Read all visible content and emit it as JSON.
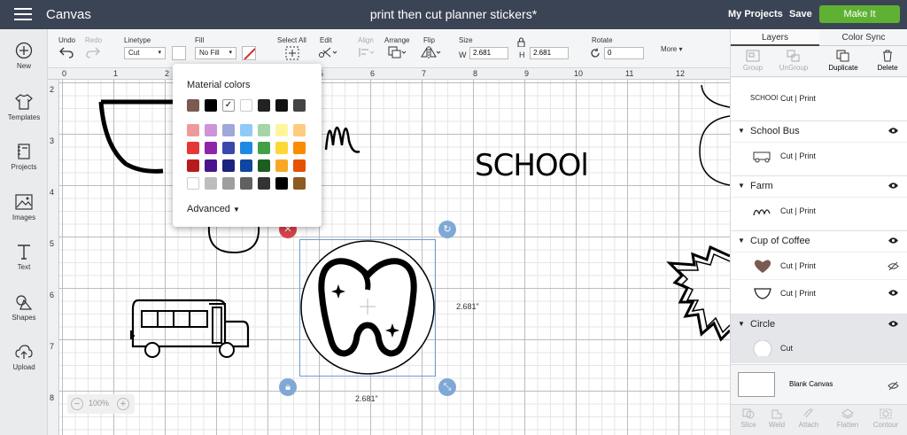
{
  "header": {
    "app_name": "Canvas",
    "project_title": "print then cut planner stickers*",
    "my_projects": "My Projects",
    "save": "Save",
    "make_it": "Make It"
  },
  "left_nav": [
    {
      "label": "New",
      "icon": "plus-circle-icon"
    },
    {
      "label": "Templates",
      "icon": "shirt-icon"
    },
    {
      "label": "Projects",
      "icon": "notebook-icon"
    },
    {
      "label": "Images",
      "icon": "image-icon"
    },
    {
      "label": "Text",
      "icon": "text-icon"
    },
    {
      "label": "Shapes",
      "icon": "shapes-icon"
    },
    {
      "label": "Upload",
      "icon": "cloud-upload-icon"
    }
  ],
  "toolbar": {
    "undo": "Undo",
    "redo": "Redo",
    "linetype_label": "Linetype",
    "linetype_value": "Cut",
    "fill_label": "Fill",
    "fill_value": "No Fill",
    "select_all": "Select All",
    "edit": "Edit",
    "align": "Align",
    "arrange": "Arrange",
    "flip": "Flip",
    "size": "Size",
    "w_label": "W",
    "w_value": "2.681",
    "h_label": "H",
    "h_value": "2.681",
    "rotate": "Rotate",
    "rotate_value": "0",
    "more": "More"
  },
  "rulers": {
    "top": [
      "0",
      "1",
      "2",
      "3",
      "4",
      "5",
      "6",
      "7",
      "8",
      "9",
      "10",
      "11",
      "12"
    ],
    "left": [
      "2",
      "3",
      "4",
      "5",
      "6",
      "7",
      "8"
    ]
  },
  "canvas": {
    "text_school": "SCHOOl",
    "width_dim": "2.681\"",
    "height_dim": "2.681\"",
    "zoom": "100%"
  },
  "material_popup": {
    "title": "Material colors",
    "advanced": "Advanced",
    "row1": [
      "#7b5a52",
      "#000000",
      "#ffffff",
      "#ffffff",
      "#222222",
      "#111111",
      "#444444"
    ],
    "grid": [
      [
        "#ef9a9a",
        "#ce93d8",
        "#9fa8da",
        "#90caf9",
        "#a5d6a7",
        "#fff59d",
        "#ffcc80"
      ],
      [
        "#e53935",
        "#8e24aa",
        "#3949ab",
        "#1e88e5",
        "#43a047",
        "#fdd835",
        "#fb8c00"
      ],
      [
        "#b71c1c",
        "#4a148c",
        "#1a237e",
        "#0d47a1",
        "#1b5e20",
        "#f9a825",
        "#e65100"
      ],
      [
        "#ffffff",
        "#bdbdbd",
        "#9e9e9e",
        "#616161",
        "#333333",
        "#000000",
        "#8d5a1f"
      ]
    ]
  },
  "layers_panel": {
    "tabs": [
      "Layers",
      "Color Sync"
    ],
    "actions": [
      "Group",
      "UnGroup",
      "Duplicate",
      "Delete"
    ],
    "top_row": {
      "ops": "Cut  | Print"
    },
    "groups": [
      {
        "name": "School Bus",
        "ops": "Cut  | Print"
      },
      {
        "name": "Farm",
        "ops": "Cut  | Print"
      },
      {
        "name": "Cup of Coffee",
        "rows": [
          "Cut  | Print",
          "Cut  | Print"
        ]
      },
      {
        "name": "Circle",
        "ops": "Cut"
      }
    ],
    "blank_canvas": "Blank Canvas",
    "bottom_actions": [
      "Slice",
      "Weld",
      "Attach",
      "Flatten",
      "Contour"
    ]
  }
}
